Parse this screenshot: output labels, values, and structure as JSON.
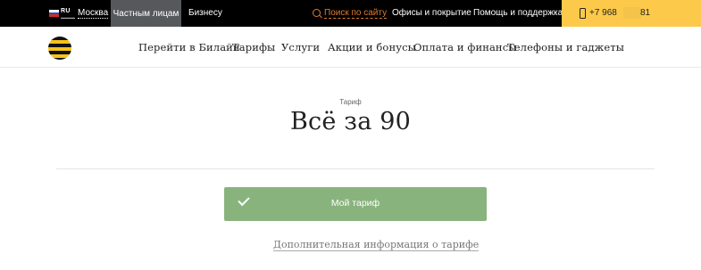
{
  "topbar": {
    "region_code": "RU",
    "region_sub": "▬▬▬▬",
    "city": "Москва",
    "segments": [
      "Частным лицам",
      "Бизнесу"
    ],
    "search_link": "Поиск по сайту",
    "offices_link": "Офисы и покрытие",
    "help_link": "Помощь и поддержка",
    "phone_prefix": "+7 968",
    "phone_suffix": "81",
    "colors": {
      "bar": "#000000",
      "active_segment": "#56595c",
      "accent": "#e07b2b",
      "phone_box": "#fcc94a"
    }
  },
  "nav": {
    "items": [
      "Перейти в Билайн",
      "Тарифы",
      "Услуги",
      "Акции и бонусы",
      "Оплата и финансы",
      "Телефоны и гаджеты"
    ]
  },
  "main": {
    "eyebrow": "Тариф",
    "title": "Всё за 90",
    "my_tariff_button": "Мой тариф",
    "more_info_link": "Дополнительная информация о тарифе",
    "colors": {
      "button": "#88b37d"
    }
  },
  "icons": [
    "flag-ru-icon",
    "search-icon",
    "phone-icon",
    "beeline-logo",
    "check-icon"
  ]
}
